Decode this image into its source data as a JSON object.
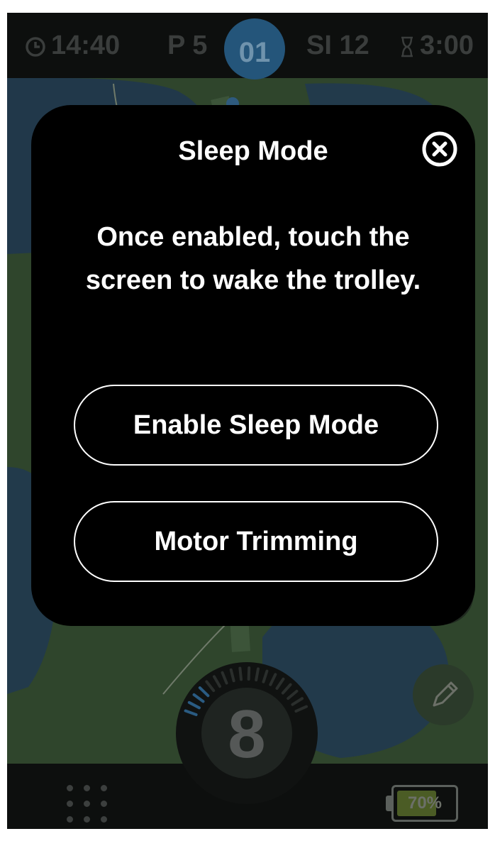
{
  "topbar": {
    "time": "14:40",
    "par": "P 5",
    "hole": "01",
    "stroke_index": "SI 12",
    "timer": "3:00"
  },
  "dial": {
    "value": "8"
  },
  "battery": {
    "label": "70%",
    "level": 0.7
  },
  "modal": {
    "title": "Sleep Mode",
    "message": "Once enabled, touch the screen to wake the trolley.",
    "enable_button": "Enable Sleep Mode",
    "motor_button": "Motor Trimming"
  },
  "icons": {
    "clock": "clock-icon",
    "hourglass": "hourglass-icon",
    "close": "close-circle-icon",
    "pencil": "pencil-icon",
    "menu": "grid-dots-icon",
    "battery": "battery-icon"
  },
  "colors": {
    "modal_bg": "#000000",
    "modal_text": "#ffffff",
    "hole_badge": "#24557a",
    "battery_fill": "#4b5c25"
  }
}
